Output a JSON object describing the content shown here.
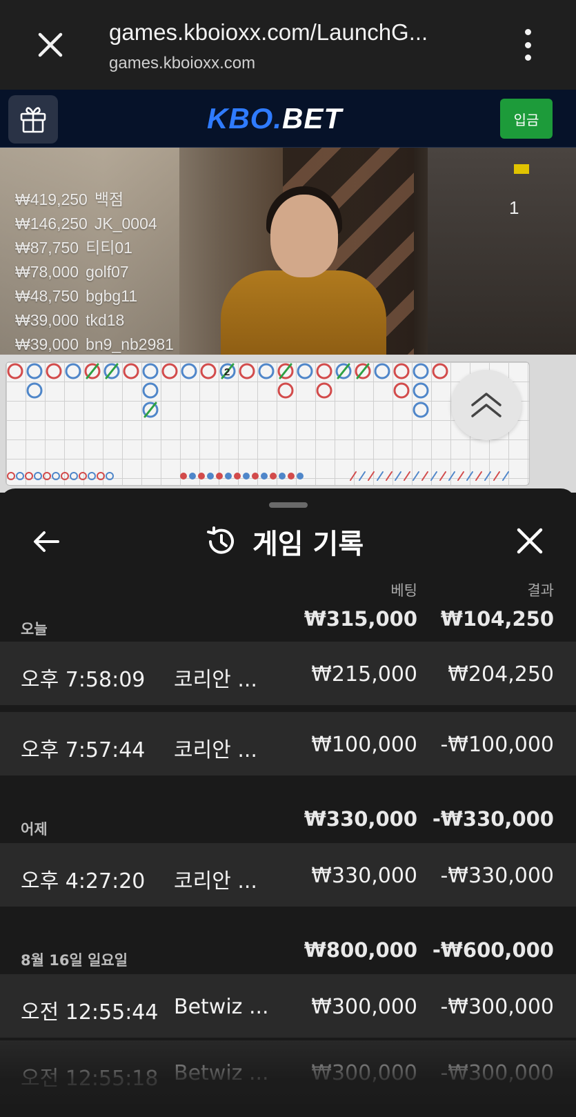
{
  "browser": {
    "url": "games.kboioxx.com/LaunchG...",
    "host": "games.kboioxx.com",
    "close_icon": "close-icon",
    "menu_icon": "more-vert-icon"
  },
  "site": {
    "logo_prefix": "KBO.",
    "logo_suffix": "BET",
    "deposit_label": "입금",
    "gift_icon": "gift-icon",
    "accent": "#2f7bff",
    "deposit_color": "#1d9b3a"
  },
  "video": {
    "table_number": "1",
    "leaderboard": [
      {
        "amount": "₩419,250",
        "name": "백점"
      },
      {
        "amount": "₩146,250",
        "name": "JK_0004"
      },
      {
        "amount": "₩87,750",
        "name": "티티01"
      },
      {
        "amount": "₩78,000",
        "name": "golf07"
      },
      {
        "amount": "₩48,750",
        "name": "bgbg11"
      },
      {
        "amount": "₩39,000",
        "name": "tkd18"
      },
      {
        "amount": "₩39,000",
        "name": "bn9_nb2981"
      }
    ]
  },
  "road": {
    "tie_count_label": "2",
    "side_markers": [
      "P",
      "B",
      "P",
      "P"
    ],
    "banker_color": "#d24b4b",
    "player_color": "#4f86c9",
    "tie_color": "#2ea043"
  },
  "history": {
    "title": "게임 기록",
    "col_bet": "베팅",
    "col_result": "결과",
    "groups": [
      {
        "label": "오늘",
        "bet": "₩315,000",
        "result": "₩104,250",
        "rows": [
          {
            "time": "오후 7:58:09",
            "game": "코리안 ...",
            "bet": "₩215,000",
            "result": "₩204,250"
          },
          {
            "time": "오후 7:57:44",
            "game": "코리안 ...",
            "bet": "₩100,000",
            "result": "-₩100,000"
          }
        ]
      },
      {
        "label": "어제",
        "bet": "₩330,000",
        "result": "-₩330,000",
        "rows": [
          {
            "time": "오후 4:27:20",
            "game": "코리안 ...",
            "bet": "₩330,000",
            "result": "-₩330,000"
          }
        ]
      },
      {
        "label": "8월 16일 일요일",
        "bet": "₩800,000",
        "result": "-₩600,000",
        "rows": [
          {
            "time": "오전 12:55:44",
            "game": "Betwiz ...",
            "bet": "₩300,000",
            "result": "-₩300,000"
          },
          {
            "time": "오전 12:55:18",
            "game": "Betwiz ...",
            "bet": "₩300,000",
            "result": "-₩300,000"
          }
        ]
      }
    ]
  }
}
